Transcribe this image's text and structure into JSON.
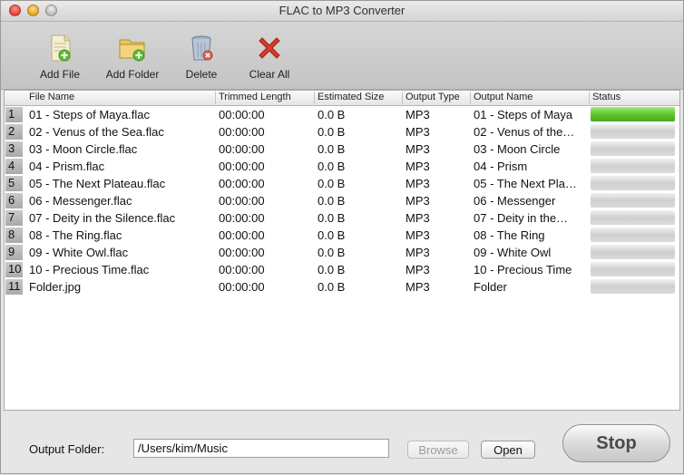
{
  "window": {
    "title": "FLAC to MP3 Converter"
  },
  "toolbar": {
    "add_file": "Add File",
    "add_folder": "Add Folder",
    "delete": "Delete",
    "clear_all": "Clear All"
  },
  "table": {
    "columns": [
      "File Name",
      "Trimmed Length",
      "Estimated Size",
      "Output Type",
      "Output Name",
      "Status"
    ],
    "rows": [
      {
        "num": "1",
        "file": "01 - Steps of Maya.flac",
        "length": "00:00:00",
        "size": "0.0 B",
        "type": "MP3",
        "output": "01 - Steps of Maya",
        "progress": 1.0
      },
      {
        "num": "2",
        "file": "02 - Venus of the Sea.flac",
        "length": "00:00:00",
        "size": "0.0 B",
        "type": "MP3",
        "output": "02 - Venus of the…",
        "progress": 0
      },
      {
        "num": "3",
        "file": "03 - Moon Circle.flac",
        "length": "00:00:00",
        "size": "0.0 B",
        "type": "MP3",
        "output": "03 - Moon Circle",
        "progress": 0
      },
      {
        "num": "4",
        "file": "04 - Prism.flac",
        "length": "00:00:00",
        "size": "0.0 B",
        "type": "MP3",
        "output": "04 - Prism",
        "progress": 0
      },
      {
        "num": "5",
        "file": "05 - The Next Plateau.flac",
        "length": "00:00:00",
        "size": "0.0 B",
        "type": "MP3",
        "output": "05 - The Next Pla…",
        "progress": 0
      },
      {
        "num": "6",
        "file": "06 - Messenger.flac",
        "length": "00:00:00",
        "size": "0.0 B",
        "type": "MP3",
        "output": "06 - Messenger",
        "progress": 0
      },
      {
        "num": "7",
        "file": "07 - Deity in the Silence.flac",
        "length": "00:00:00",
        "size": "0.0 B",
        "type": "MP3",
        "output": "07 - Deity in the…",
        "progress": 0
      },
      {
        "num": "8",
        "file": "08 - The Ring.flac",
        "length": "00:00:00",
        "size": "0.0 B",
        "type": "MP3",
        "output": "08 - The Ring",
        "progress": 0
      },
      {
        "num": "9",
        "file": "09 - White Owl.flac",
        "length": "00:00:00",
        "size": "0.0 B",
        "type": "MP3",
        "output": "09 - White Owl",
        "progress": 0
      },
      {
        "num": "10",
        "file": "10 - Precious Time.flac",
        "length": "00:00:00",
        "size": "0.0 B",
        "type": "MP3",
        "output": "10 - Precious Time",
        "progress": 0
      },
      {
        "num": "11",
        "file": "Folder.jpg",
        "length": "00:00:00",
        "size": "0.0 B",
        "type": "MP3",
        "output": "Folder",
        "progress": 0
      }
    ]
  },
  "bottom": {
    "output_folder_label": "Output Folder:",
    "output_folder_value": "/Users/kim/Music",
    "browse_label": "Browse",
    "open_label": "Open",
    "stop_label": "Stop"
  },
  "icons": {
    "add_file": "document-add-icon",
    "add_folder": "folder-add-icon",
    "delete": "trash-icon",
    "clear_all": "red-x-icon"
  },
  "colors": {
    "progress_fill": "#5fc52e",
    "clear_x": "#d93a2b"
  }
}
